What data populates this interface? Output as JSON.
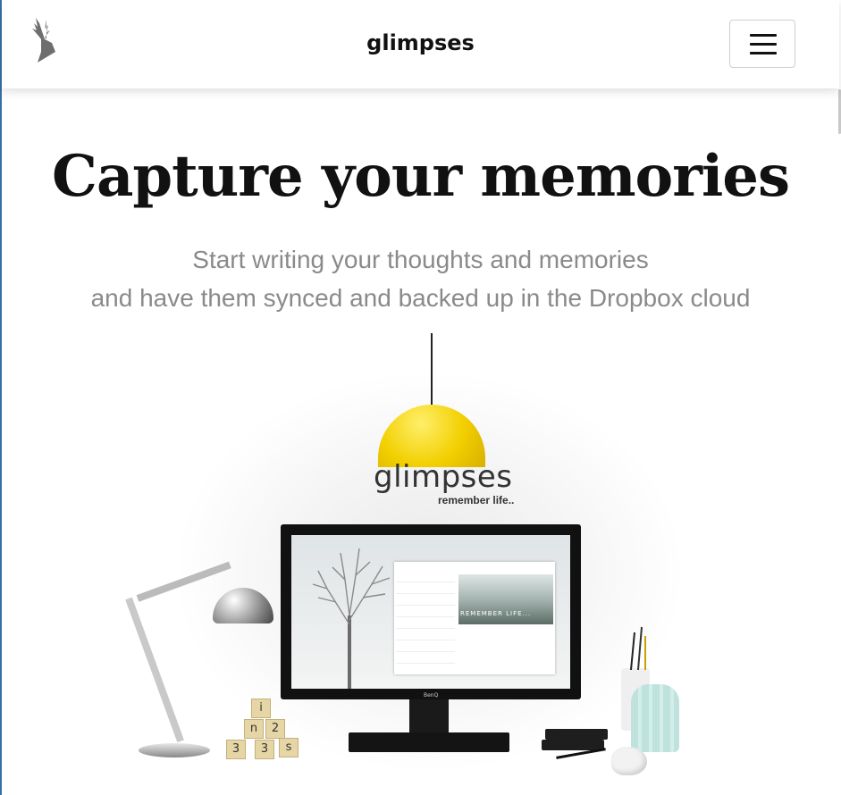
{
  "nav": {
    "brand": "glimpses",
    "logo_icon": "deer-head-icon",
    "menu_icon": "hamburger-menu-icon"
  },
  "hero": {
    "title": "Capture your memories",
    "subtitle_line1": "Start writing your thoughts and memories",
    "subtitle_line2": "and have them synced and backed up in the Dropbox cloud"
  },
  "illustration": {
    "brand_text": "glimpses",
    "tagline": "remember life..",
    "screen_caption": "REMEMBER LIFE...",
    "monitor_brand": "BenQ",
    "cube_letters": [
      "i",
      "n",
      "2",
      "3",
      "3",
      "s"
    ],
    "lamp_color": "#f2cf00"
  }
}
